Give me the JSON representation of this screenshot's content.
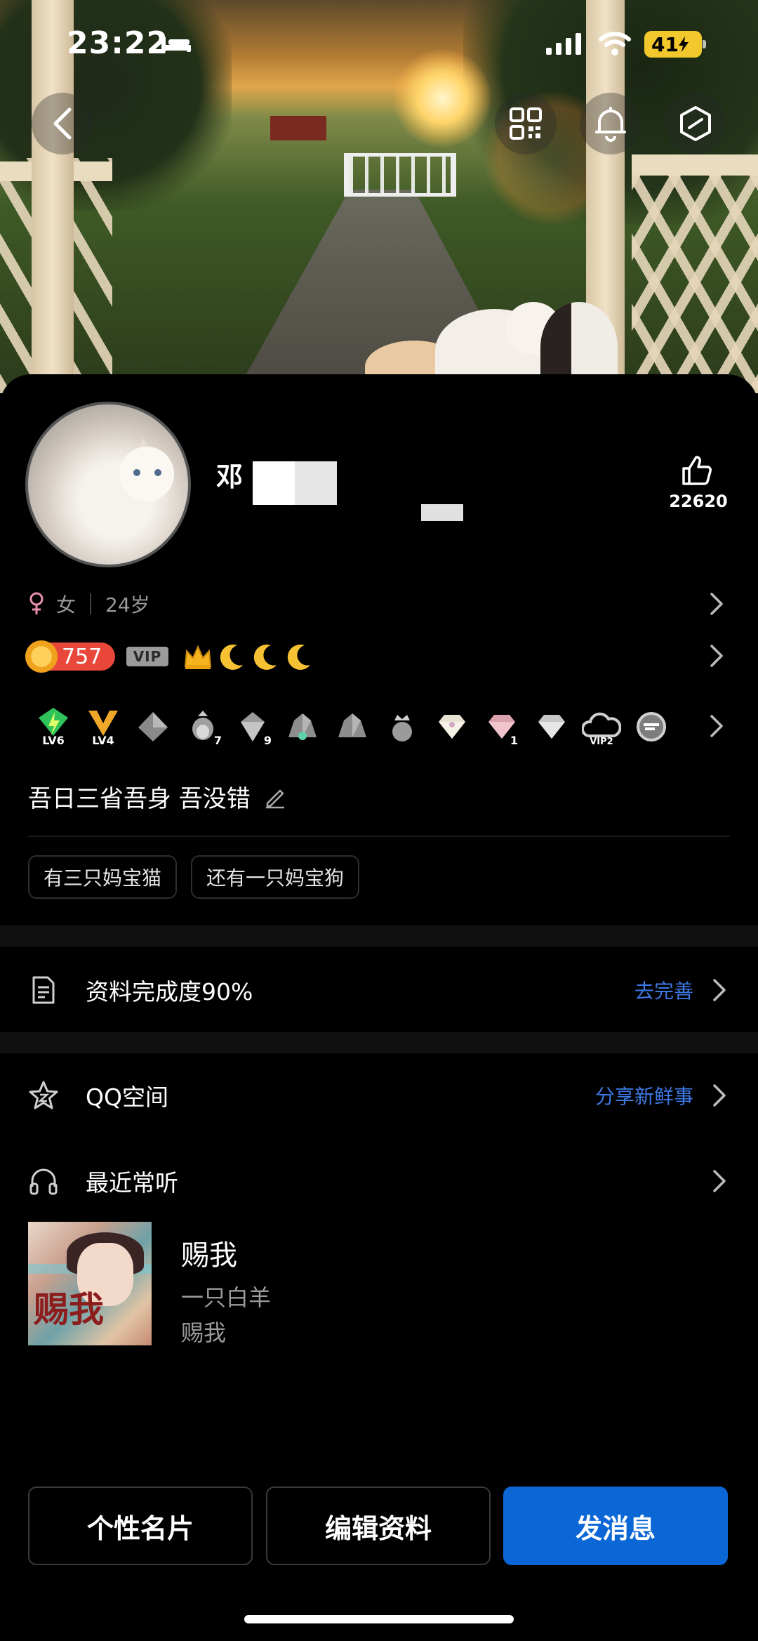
{
  "status_bar": {
    "time": "23:22",
    "battery": "41"
  },
  "header": {
    "icons": [
      "back-icon",
      "qr-code-icon",
      "bell-icon",
      "hexagon-settings-icon"
    ]
  },
  "profile": {
    "nickname": "邓",
    "likes": "22620",
    "gender": "女",
    "age": "24岁",
    "coin_level": "757",
    "vip_label": "VIP",
    "badges": [
      {
        "name": "lv6-badge",
        "label": "LV6"
      },
      {
        "name": "lv4-badge",
        "label": "LV4"
      },
      {
        "name": "gray-diamond-badge",
        "label": ""
      },
      {
        "name": "penguin-7-badge",
        "label": "7"
      },
      {
        "name": "diamond-9-badge",
        "label": "9"
      },
      {
        "name": "gray-gem-badge",
        "label": ""
      },
      {
        "name": "gray-gem-badge-2",
        "label": ""
      },
      {
        "name": "crown-penguin-badge",
        "label": ""
      },
      {
        "name": "white-diamond-badge",
        "label": ""
      },
      {
        "name": "pink-diamond-1-badge",
        "label": "1"
      },
      {
        "name": "silver-diamond-badge",
        "label": ""
      },
      {
        "name": "vip2-cloud-badge",
        "label": "VIP2"
      },
      {
        "name": "cf-badge",
        "label": ""
      }
    ],
    "signature": "吾日三省吾身 吾没错",
    "tags": [
      "有三只妈宝猫",
      "还有一只妈宝狗"
    ]
  },
  "rows": {
    "completion": {
      "label": "资料完成度90%",
      "action": "去完善"
    },
    "qzone": {
      "label": "QQ空间",
      "action": "分享新鲜事"
    },
    "recent": {
      "label": "最近常听"
    }
  },
  "song": {
    "title": "赐我",
    "artist": "一只白羊",
    "album": "赐我",
    "cover_text": "赐我"
  },
  "buttons": {
    "card": "个性名片",
    "edit": "编辑资料",
    "message": "发消息"
  },
  "colors": {
    "accent_blue": "#0b67d6",
    "link_blue": "#3e78e3",
    "coin_red": "#e8473a",
    "battery_yellow": "#f2c82c"
  }
}
